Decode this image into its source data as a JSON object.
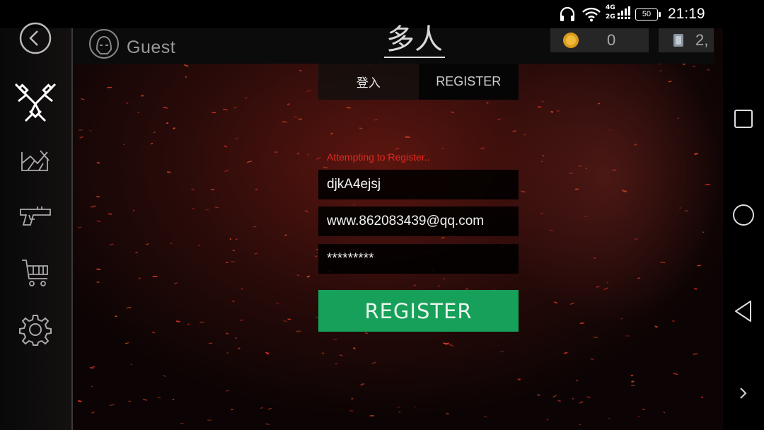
{
  "status_bar": {
    "time": "21:19",
    "battery": "50",
    "network_top": "4G",
    "network_bottom": "2G",
    "icons": [
      "headphones-icon",
      "wifi-icon",
      "signal-icon",
      "battery-icon"
    ]
  },
  "header": {
    "player_name": "Guest",
    "mode_title": "多人",
    "coins_value": "0",
    "cards_value": "2,"
  },
  "sidebar": {
    "items": [
      {
        "icon": "back-icon"
      },
      {
        "icon": "crossed-guns-icon"
      },
      {
        "icon": "map-icon"
      },
      {
        "icon": "pistol-icon"
      },
      {
        "icon": "shopping-cart-icon"
      },
      {
        "icon": "gear-icon"
      }
    ]
  },
  "auth": {
    "tabs": [
      {
        "label": "登入",
        "active": false
      },
      {
        "label": "REGISTER",
        "active": true
      }
    ],
    "status_message": "Attempting to Register..",
    "username_value": "djkA4ejsj",
    "email_value": "www.862083439@qq.com",
    "password_value": "*********",
    "register_label": "REGISTER"
  },
  "colors": {
    "accent_green": "#17a05a",
    "status_red": "#e0291f",
    "panel_dark": "#050505"
  },
  "nav_bar": {
    "buttons": [
      "recents-icon",
      "home-icon",
      "back-triangle-icon",
      "chevron-right-icon"
    ]
  }
}
